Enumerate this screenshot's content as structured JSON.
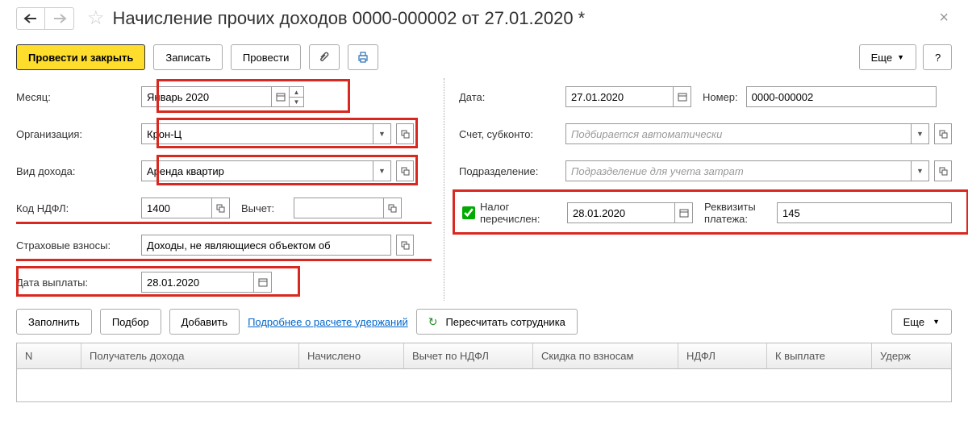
{
  "header": {
    "title": "Начисление прочих доходов 0000-000002 от 27.01.2020 *"
  },
  "toolbar": {
    "post_and_close": "Провести и закрыть",
    "write": "Записать",
    "post": "Провести",
    "more": "Еще",
    "help": "?"
  },
  "fields": {
    "month_label": "Месяц:",
    "month_value": "Январь 2020",
    "org_label": "Организация:",
    "org_value": "Крон-Ц",
    "income_type_label": "Вид дохода:",
    "income_type_value": "Аренда квартир",
    "ndfl_code_label": "Код НДФЛ:",
    "ndfl_code_value": "1400",
    "deduction_label": "Вычет:",
    "deduction_value": "",
    "insurance_label": "Страховые взносы:",
    "insurance_value": "Доходы, не являющиеся объектом об",
    "payment_date_label": "Дата выплаты:",
    "payment_date_value": "28.01.2020",
    "date_label": "Дата:",
    "date_value": "27.01.2020",
    "number_label": "Номер:",
    "number_value": "0000-000002",
    "account_label": "Счет, субконто:",
    "account_placeholder": "Подбирается автоматически",
    "dept_label": "Подразделение:",
    "dept_placeholder": "Подразделение для учета затрат",
    "tax_paid_label": "Налог перечислен:",
    "tax_paid_date": "28.01.2020",
    "payment_req_label": "Реквизиты платежа:",
    "payment_req_value": "145"
  },
  "table_toolbar": {
    "fill": "Заполнить",
    "pick": "Подбор",
    "add": "Добавить",
    "details_link": "Подробнее о расчете удержаний",
    "recalc": "Пересчитать сотрудника",
    "more": "Еще"
  },
  "table": {
    "columns": [
      "N",
      "Получатель дохода",
      "Начислено",
      "Вычет по НДФЛ",
      "Скидка по взносам",
      "НДФЛ",
      "К выплате",
      "Удерж"
    ]
  }
}
